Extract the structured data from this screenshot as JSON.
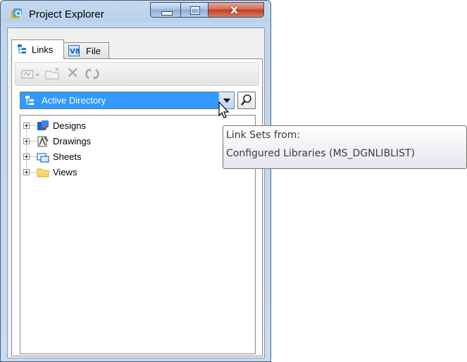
{
  "window": {
    "title": "Project Explorer",
    "buttons": {
      "minimize": "minimize",
      "maximize": "maximize",
      "close": "close"
    }
  },
  "tabs": [
    {
      "label": "Links",
      "icon": "links-tree-icon",
      "selected": true
    },
    {
      "label": "File",
      "icon": "v8-file-icon",
      "selected": false
    }
  ],
  "toolbar": {
    "items": [
      "link-set-dropdown-icon",
      "open-folder-icon",
      "delete-icon",
      "refresh-icon"
    ]
  },
  "combo": {
    "value": "Active Directory",
    "icon": "links-tree-icon"
  },
  "search_button": {
    "icon": "magnifier-icon"
  },
  "tree": {
    "nodes": [
      {
        "label": "Designs",
        "icon": "designs-icon"
      },
      {
        "label": "Drawings",
        "icon": "drawings-icon"
      },
      {
        "label": "Sheets",
        "icon": "sheets-icon"
      },
      {
        "label": "Views",
        "icon": "folder-icon"
      }
    ]
  },
  "tooltip": {
    "line1": "Link Sets from:",
    "line2": "Configured Libraries (MS_DGNLIBLIST)"
  },
  "colors": {
    "selection": "#3399ff",
    "frame": "#c4d9ef",
    "close_button": "#c03f26"
  }
}
